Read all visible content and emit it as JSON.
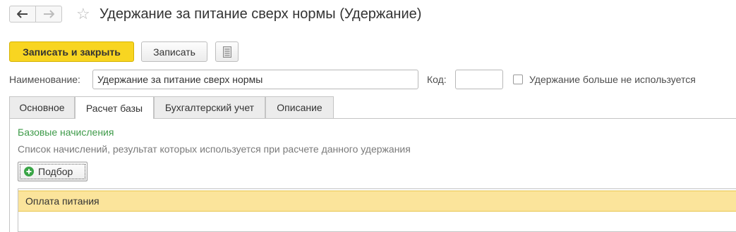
{
  "window": {
    "title": "Удержание за питание сверх нормы (Удержание)"
  },
  "toolbar": {
    "save_close_label": "Записать и закрыть",
    "save_label": "Записать"
  },
  "form": {
    "name_label": "Наименование:",
    "name_value": "Удержание за питание сверх нормы",
    "code_label": "Код:",
    "code_value": "",
    "unused_label": "Удержание больше не используется",
    "unused_checked": false
  },
  "tabs": [
    {
      "label": "Основное"
    },
    {
      "label": "Расчет базы",
      "active": true
    },
    {
      "label": "Бухгалтерский учет"
    },
    {
      "label": "Описание"
    }
  ],
  "base": {
    "title": "Базовые начисления",
    "description": "Список начислений, результат которых используется при расчете данного удержания",
    "pick_label": "Подбор",
    "rows": [
      "Оплата питания"
    ]
  },
  "colors": {
    "accent_button": "#f8d521",
    "section_title": "#3f9b4a",
    "selected_row": "#fbe49b"
  },
  "icons": [
    "arrow-left-icon",
    "arrow-right-icon",
    "star-icon",
    "document-icon",
    "plus-circle-icon"
  ]
}
